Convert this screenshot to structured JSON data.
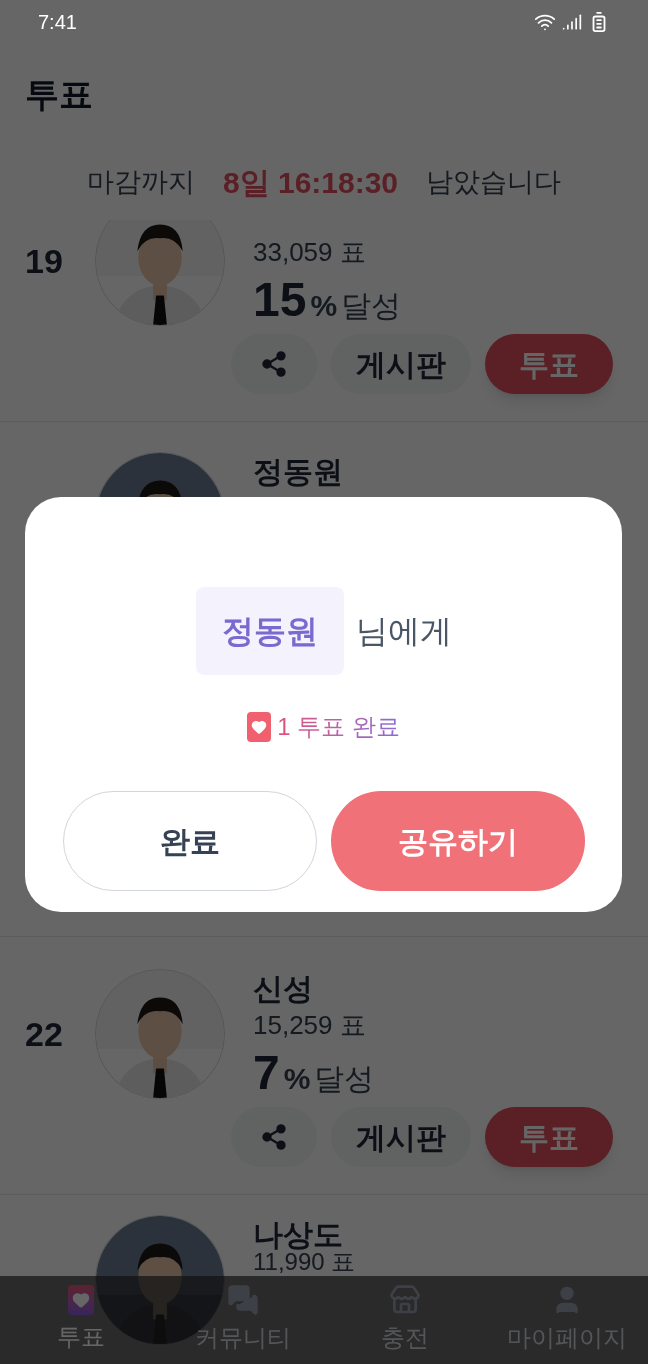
{
  "status_bar": {
    "time": "7:41"
  },
  "header": {
    "title": "투표"
  },
  "countdown": {
    "prefix": "마감까지",
    "remaining": "8일 16:18:30",
    "suffix": "남았습니다"
  },
  "candidates": [
    {
      "kind": "full",
      "rank": "19",
      "votes": "33,059 표",
      "percent": "15",
      "percent_sign": "%",
      "achieved": "달성",
      "board": "게시판",
      "vote": "투표"
    },
    {
      "kind": "covered",
      "name": "정동원"
    },
    {
      "kind": "full",
      "rank": "22",
      "name": "신성",
      "votes": "15,259 표",
      "percent": "7",
      "percent_sign": "%",
      "achieved": "달성",
      "board": "게시판",
      "vote": "투표"
    },
    {
      "kind": "partial",
      "name": "나상도",
      "votes": "11,990 표"
    }
  ],
  "dialog": {
    "recipient": "정동원",
    "recipient_suffix": "님에게",
    "result": "1 투표 완료",
    "buttons": [
      {
        "label": "완료",
        "kind": "outline"
      },
      {
        "label": "공유하기",
        "kind": "primary"
      }
    ]
  },
  "bottom_nav": [
    {
      "label": "투표",
      "selected": true
    },
    {
      "label": "커뮤니티",
      "selected": false
    },
    {
      "label": "충전",
      "selected": false
    },
    {
      "label": "마이페이지",
      "selected": false
    }
  ]
}
